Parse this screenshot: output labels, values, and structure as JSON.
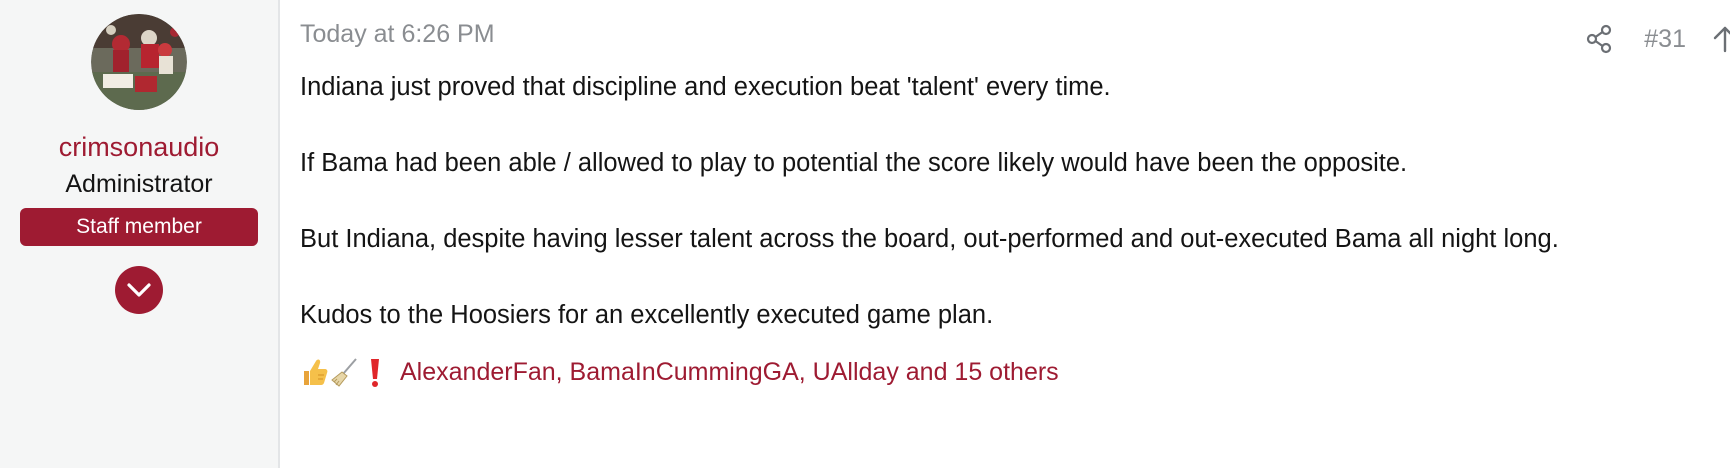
{
  "user": {
    "name": "crimsonaudio",
    "title": "Administrator",
    "badge": "Staff member"
  },
  "post": {
    "date": "Today at 6:26 PM",
    "number": "#31",
    "paragraphs": [
      "Indiana just proved that discipline and execution beat 'talent' every time.",
      "If Bama had been able / allowed to play to potential the score likely would have been the opposite.",
      "But Indiana, despite having lesser talent across the board, out-performed and out-executed Bama all night long.",
      "Kudos to the Hoosiers for an excellently executed game plan."
    ],
    "reactions": {
      "icons": [
        "thumbs-up-icon",
        "broom-icon",
        "exclamation-icon"
      ],
      "text": "AlexanderFan, BamaInCummingGA, UAllday and 15 others"
    }
  },
  "colors": {
    "accent": "#9e1b32",
    "muted": "#8a8d91",
    "sidebar_bg": "#f5f6f6"
  }
}
